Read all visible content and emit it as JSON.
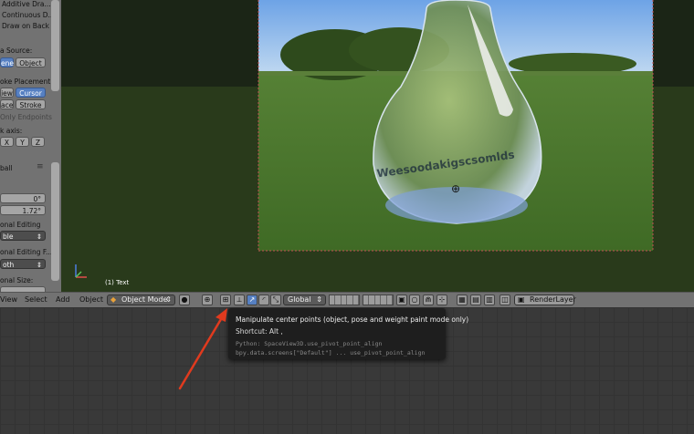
{
  "left_panel": {
    "opt_additive": "Additive Dra...",
    "opt_continuous": "Continuous D...",
    "opt_draw_on_back": "Draw on Back",
    "data_source_label": "a Source:",
    "data_source_options": [
      "ene",
      "Object"
    ],
    "stroke_placement_label": "oke Placement:",
    "stroke_placement_row1": [
      "iew",
      "Cursor"
    ],
    "stroke_placement_row2": [
      "ace",
      "Stroke"
    ],
    "only_endpoints": "Only Endpoints",
    "axis_label": "k axis:",
    "axes": [
      "X",
      "Y",
      "Z"
    ],
    "item_name": "ball",
    "value_1": "0°",
    "value_2": "1.72°",
    "proportional_editing_label": "onal Editing",
    "proportional_editing_value": "ble",
    "proportional_falloff_label": "onal Editing F...",
    "proportional_falloff_value": "oth",
    "proportional_size_label": "onal Size:"
  },
  "viewport": {
    "object_label": "(1) Text",
    "drop_text": "Weesoodakigscsomlds"
  },
  "header": {
    "menus": [
      "View",
      "Select",
      "Add",
      "Object"
    ],
    "mode": "Object Mode",
    "orientation": "Global",
    "render_layer": "RenderLayer",
    "icons": [
      "viewport-shading-icon",
      "pivot-point-icon",
      "pivot-center-points-icon",
      "manipulator-icon",
      "translate-icon",
      "rotate-icon",
      "scale-icon",
      "layer-lock-icon",
      "render-icon"
    ]
  },
  "tooltip": {
    "title": "Manipulate center points (object, pose and weight paint mode only)",
    "shortcut": "Shortcut: Alt ,",
    "python_1": "Python: SpaceView3D.use_pivot_point_align",
    "python_2": "bpy.data.screens[\"Default\"] ... use_pivot_point_align"
  },
  "colors": {
    "panel_bg": "#727272",
    "selected_blue": "#5680c2",
    "tooltip_bg": "#1e1e1e",
    "arrow_red": "#e03a1e"
  }
}
